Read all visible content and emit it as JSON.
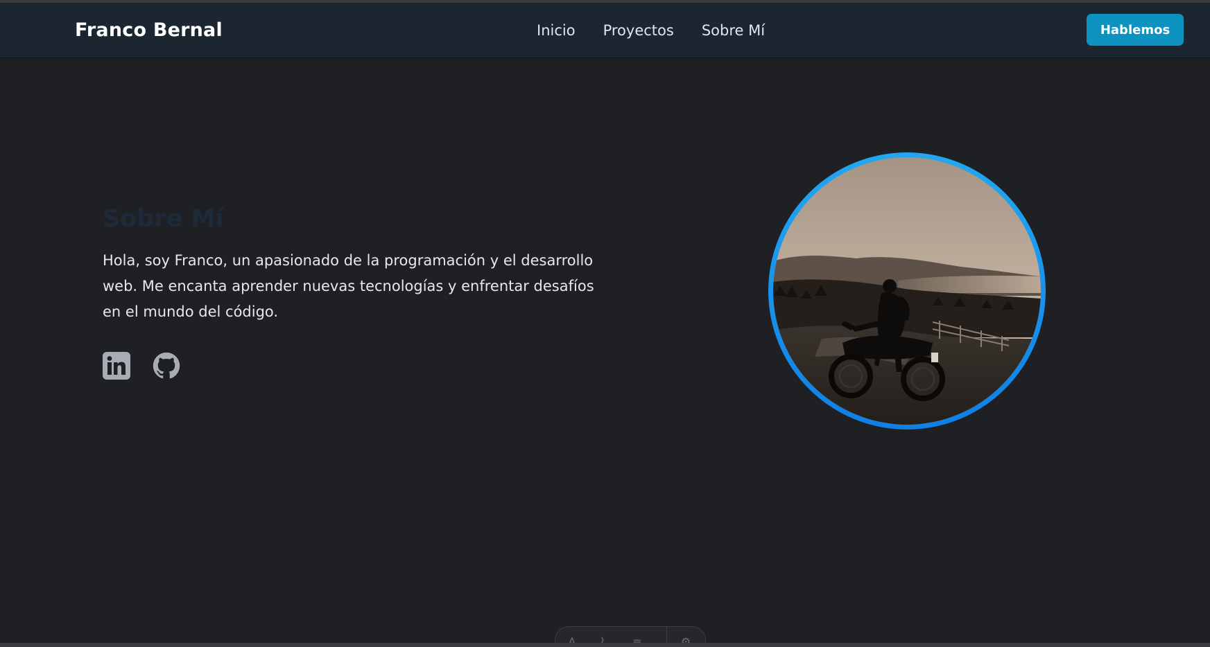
{
  "header": {
    "brand": "Franco Bernal",
    "nav": [
      "Inicio",
      "Proyectos",
      "Sobre Mí"
    ],
    "cta_label": "Hablemos"
  },
  "about": {
    "title": "Sobre Mí",
    "text": "Hola, soy Franco, un apasionado de la programación y el desarrollo web. Me encanta aprender nuevas tecnologías y enfrentar desafíos en el mundo del código."
  },
  "socials": [
    {
      "icon": "linkedin-icon"
    },
    {
      "icon": "github-icon"
    }
  ],
  "colors": {
    "background": "#1f2024",
    "navbar": "#1c2631",
    "accent": "#0e93c0",
    "ring": "#1a95ee",
    "title": "#1e2a3a"
  }
}
